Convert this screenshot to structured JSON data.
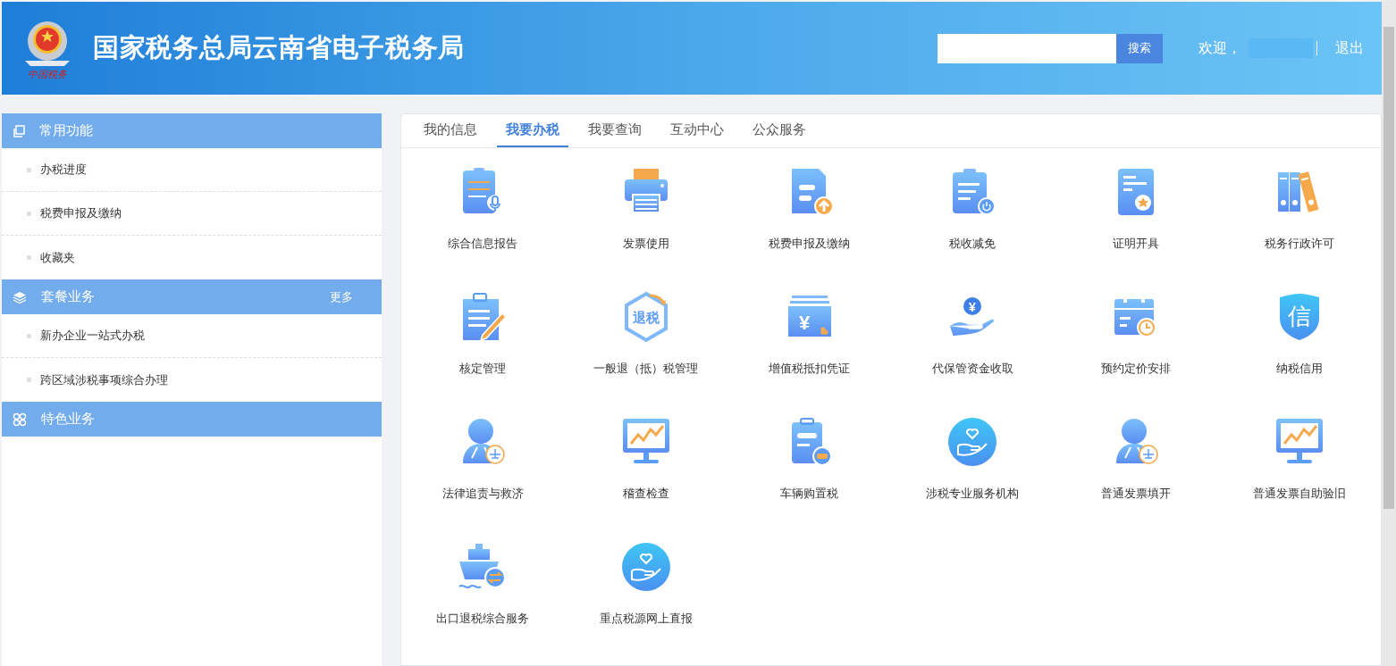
{
  "header": {
    "logo_caption": "中国税务",
    "title": "国家税务总局云南省电子税务局",
    "search": {
      "button": "搜索"
    },
    "welcome": "欢迎，",
    "logout": "退出"
  },
  "sidebar": {
    "sections": [
      {
        "title": "常用功能",
        "kind": "copy",
        "items": [
          "办税进度",
          "税费申报及缴纳",
          "收藏夹"
        ]
      },
      {
        "title": "套餐业务",
        "kind": "layers",
        "more": "更多",
        "items": [
          "新办企业一站式办税",
          "跨区域涉税事项综合办理"
        ]
      },
      {
        "title": "特色业务",
        "kind": "clover"
      }
    ]
  },
  "tabs": [
    {
      "label": "我的信息",
      "selected": false
    },
    {
      "label": "我要办税",
      "selected": true
    },
    {
      "label": "我要查询",
      "selected": false
    },
    {
      "label": "互动中心",
      "selected": false
    },
    {
      "label": "公众服务",
      "selected": false
    }
  ],
  "services": [
    {
      "label": "综合信息报告",
      "kind": "clipboard-mic"
    },
    {
      "label": "发票使用",
      "kind": "printer"
    },
    {
      "label": "税费申报及缴纳",
      "kind": "doc-upload"
    },
    {
      "label": "税收减免",
      "kind": "clipboard-power"
    },
    {
      "label": "证明开具",
      "kind": "certificate"
    },
    {
      "label": "税务行政许可",
      "kind": "binders"
    },
    {
      "label": "核定管理",
      "kind": "clipboard-pencil"
    },
    {
      "label": "一般退（抵）税管理",
      "kind": "hexagon",
      "icon_text": "退税"
    },
    {
      "label": "增值税抵扣凭证",
      "kind": "money-card",
      "icon_text": "¥"
    },
    {
      "label": "代保管资金收取",
      "kind": "hand-coin",
      "icon_text": "¥"
    },
    {
      "label": "预约定价安排",
      "kind": "calendar-clock"
    },
    {
      "label": "纳税信用",
      "kind": "shield",
      "icon_text": "信"
    },
    {
      "label": "法律追责与救济",
      "kind": "person-scale"
    },
    {
      "label": "稽查检查",
      "kind": "monitor-chart"
    },
    {
      "label": "车辆购置税",
      "kind": "clipboard-car"
    },
    {
      "label": "涉税专业服务机构",
      "kind": "heart-hand"
    },
    {
      "label": "普通发票填开",
      "kind": "person-scale"
    },
    {
      "label": "普通发票自助验旧",
      "kind": "monitor-chart"
    },
    {
      "label": "出口退税综合服务",
      "kind": "ship"
    },
    {
      "label": "重点税源网上直报",
      "kind": "heart-hand"
    }
  ]
}
